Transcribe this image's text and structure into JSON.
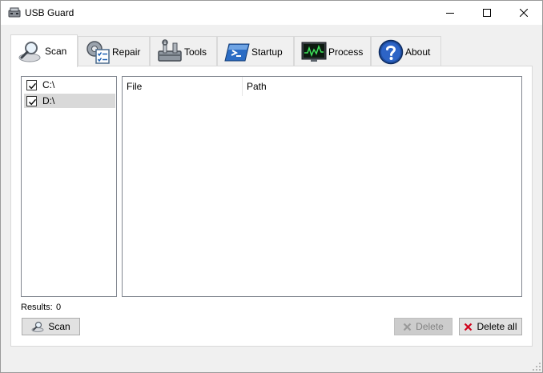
{
  "window": {
    "title": "USB Guard",
    "icon": "usb-drive-icon"
  },
  "tabs": [
    {
      "label": "Scan",
      "icon": "magnifier-icon",
      "active": true
    },
    {
      "label": "Repair",
      "icon": "gear-checklist-icon",
      "active": false
    },
    {
      "label": "Tools",
      "icon": "toolbox-icon",
      "active": false
    },
    {
      "label": "Startup",
      "icon": "console-icon",
      "active": false
    },
    {
      "label": "Process",
      "icon": "monitor-graph-icon",
      "active": false
    },
    {
      "label": "About",
      "icon": "help-icon",
      "active": false
    }
  ],
  "drives": [
    {
      "label": "C:\\",
      "checked": true,
      "selected": false
    },
    {
      "label": "D:\\",
      "checked": true,
      "selected": true
    }
  ],
  "results_table": {
    "columns": [
      "File",
      "Path"
    ],
    "rows": []
  },
  "status": {
    "results_label": "Results:",
    "results_count": "0"
  },
  "buttons": {
    "scan": "Scan",
    "delete": "Delete",
    "delete_all": "Delete all"
  },
  "colors": {
    "accent_blue": "#1a5fb4",
    "delete_red": "#d0021b",
    "disabled_text": "#838383"
  }
}
